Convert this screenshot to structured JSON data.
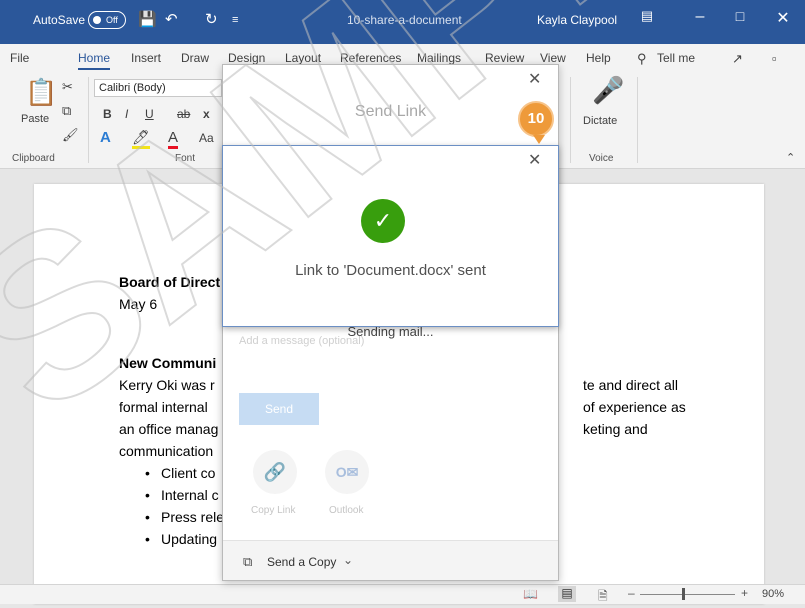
{
  "titlebar": {
    "autosave_label": "AutoSave",
    "autosave_state": "Off",
    "document_name": "10-share-a-document",
    "user_name": "Kayla Claypool"
  },
  "tabs": [
    "File",
    "Home",
    "Insert",
    "Draw",
    "Design",
    "Layout",
    "References",
    "Mailings",
    "Review",
    "View",
    "Help",
    "Tell me"
  ],
  "ribbon": {
    "paste_label": "Paste",
    "font_name": "Calibri (Body)",
    "clipboard_label": "Clipboard",
    "font_label": "Font",
    "dictate_label": "Dictate",
    "voice_label": "Voice",
    "aa_label": "Aa"
  },
  "share_panel": {
    "header": "Send Link",
    "sending_status": "Sending mail...",
    "message_placeholder": "Add a message (optional)",
    "send_label": "Send",
    "copy_link_label": "Copy Link",
    "outlook_label": "Outlook",
    "send_copy_label": "Send a Copy"
  },
  "confirmation": {
    "message": "Link to 'Document.docx' sent"
  },
  "step_badge": "10",
  "document": {
    "heading": "Board of Direct",
    "date": "May 6",
    "section": "New Communi",
    "para_left": [
      "Kerry Oki was r",
      "formal internal",
      "an office manag",
      "communication"
    ],
    "para_right": [
      "te and direct all",
      "of experience as",
      "keting and"
    ],
    "bullets": [
      "Client co",
      "Internal c",
      "Press rele",
      "Updating"
    ]
  },
  "statusbar": {
    "zoom": "90%"
  },
  "watermark_text": "SAMPLE ONLY"
}
